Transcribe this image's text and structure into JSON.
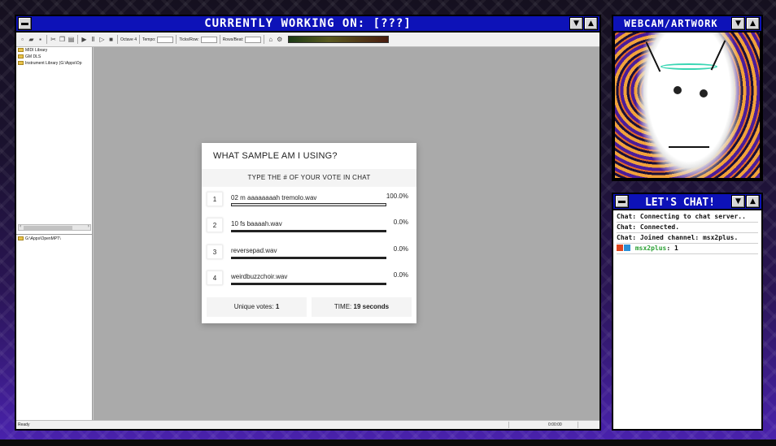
{
  "main_window": {
    "title": "CURRENTLY WORKING ON: [???]",
    "toolbar": {
      "octave_label": "Octave 4",
      "tempo_label": "Tempo:",
      "ticks_row_label": "Ticks/Row:",
      "rows_beat_label": "Rows/Beat:"
    },
    "tree_top": [
      "MIDI Library",
      "GM DLS",
      "Instrument Library (G:\\Apps\\Op"
    ],
    "tree_bottom": [
      "G:\\Apps\\OpenMPT\\"
    ],
    "status": {
      "left": "Ready",
      "time": "0:00:00"
    }
  },
  "poll": {
    "title": "WHAT SAMPLE AM I USING?",
    "subtitle": "TYPE THE # OF YOUR VOTE IN CHAT",
    "options": [
      {
        "num": "1",
        "label": "02 m aaaaaaaah tremolo.wav",
        "percent": "100.0%",
        "share": 1.0
      },
      {
        "num": "2",
        "label": "10 fs baaaah.wav",
        "percent": "0.0%",
        "share": 0.0
      },
      {
        "num": "3",
        "label": "reversepad.wav",
        "percent": "0.0%",
        "share": 0.0
      },
      {
        "num": "4",
        "label": "weirdbuzzchoir.wav",
        "percent": "0.0%",
        "share": 0.0
      }
    ],
    "unique_label": "Unique votes:",
    "unique_value": "1",
    "time_label": "TIME:",
    "time_value": "19 seconds"
  },
  "webcam": {
    "title": "WEBCAM/ARTWORK"
  },
  "chat": {
    "title": "LET'S CHAT!",
    "lines": [
      "Chat: Connecting to chat server..",
      "Chat: Connected.",
      "Chat: Joined channel: msx2plus."
    ],
    "message": {
      "user": "msx2plus",
      "text": ": 1"
    }
  },
  "colors": {
    "titlebar": "#0d12b8",
    "workspace": "#aaaaaa",
    "chat_user": "#2aa033"
  }
}
